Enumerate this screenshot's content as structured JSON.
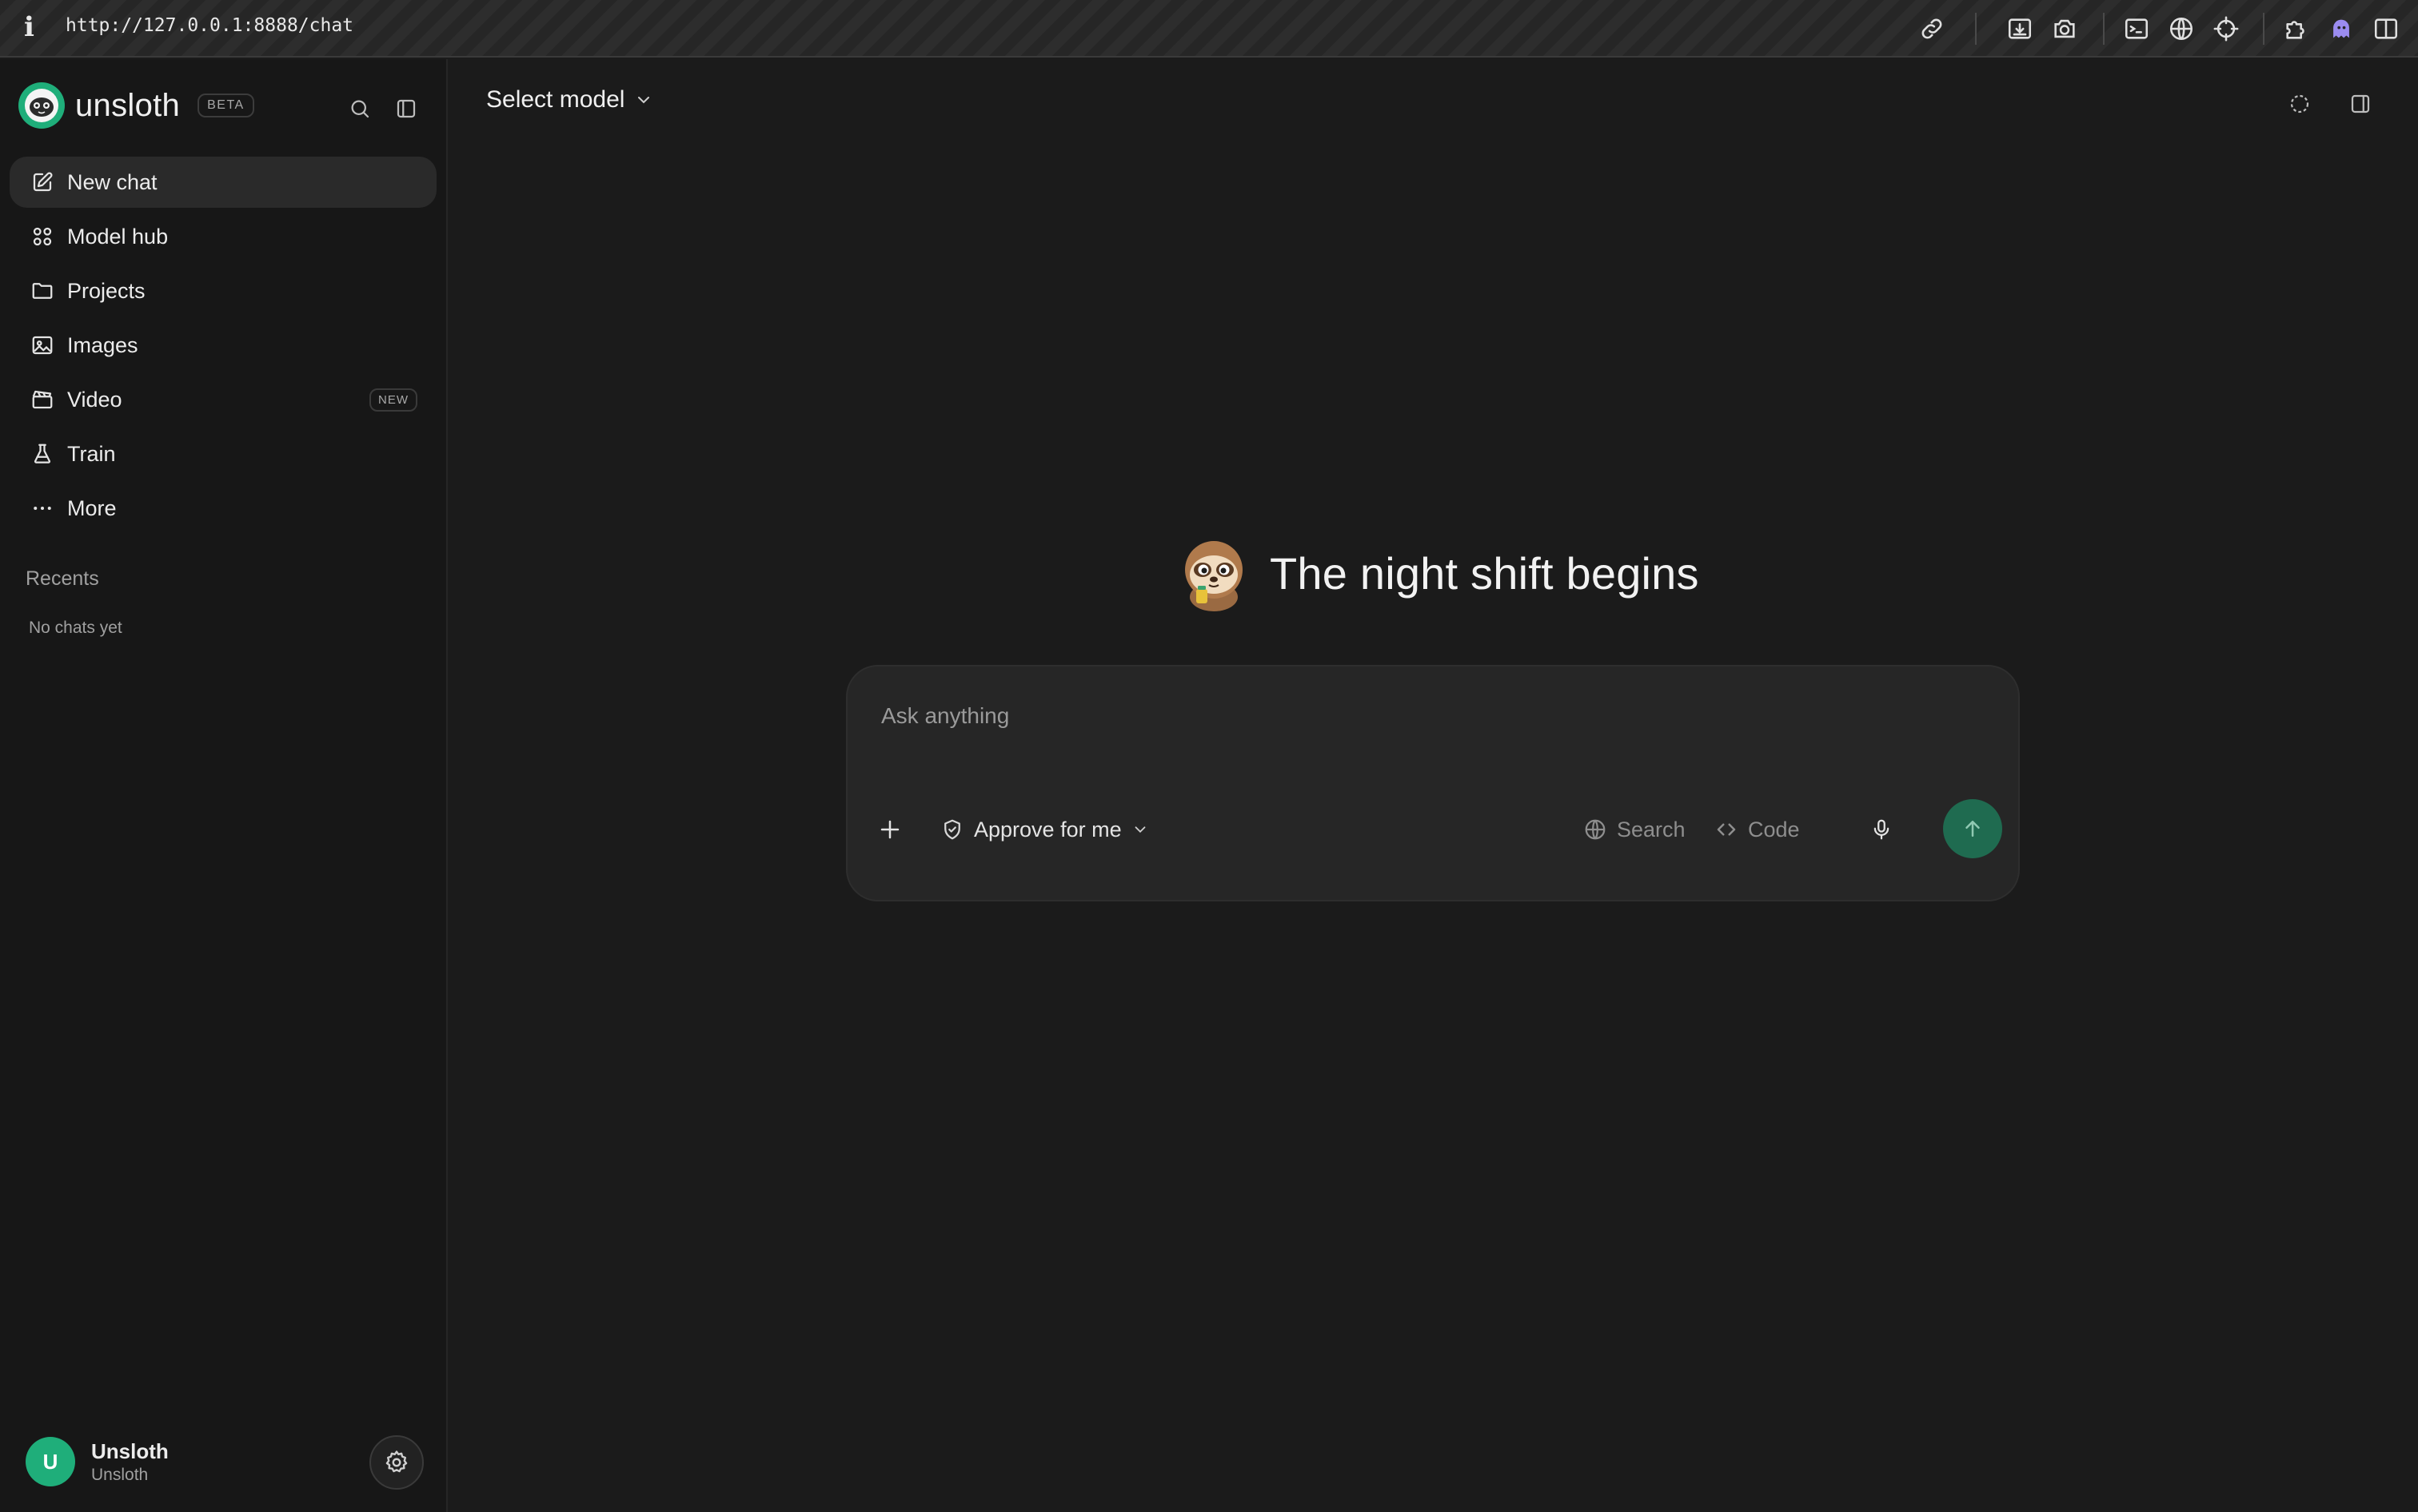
{
  "browser": {
    "info_glyph": "i",
    "url": "http://127.0.0.1:8888/chat",
    "toolbar_icons": [
      "link-icon",
      "download-box-icon",
      "camera-icon",
      "terminal-icon",
      "globe-icon",
      "crosshair-icon",
      "puzzle-icon",
      "ghost-icon",
      "split-view-icon"
    ]
  },
  "sidebar": {
    "brand": {
      "name": "unsloth",
      "badge": "BETA"
    },
    "nav": [
      {
        "id": "new-chat",
        "label": "New chat",
        "icon": "edit-icon",
        "active": true
      },
      {
        "id": "model-hub",
        "label": "Model hub",
        "icon": "grid-icon"
      },
      {
        "id": "projects",
        "label": "Projects",
        "icon": "folder-icon"
      },
      {
        "id": "images",
        "label": "Images",
        "icon": "image-icon"
      },
      {
        "id": "video",
        "label": "Video",
        "icon": "clapperboard-icon",
        "badge": "NEW"
      },
      {
        "id": "train",
        "label": "Train",
        "icon": "flask-icon"
      },
      {
        "id": "more",
        "label": "More",
        "icon": "ellipsis-icon"
      }
    ],
    "recents": {
      "heading": "Recents",
      "empty": "No chats yet"
    },
    "user": {
      "initial": "U",
      "name": "Unsloth",
      "subtitle": "Unsloth"
    }
  },
  "main": {
    "model_select": {
      "label": "Select model"
    },
    "greeting": {
      "title": "The night shift begins"
    },
    "composer": {
      "placeholder": "Ask anything",
      "value": "",
      "approve_label": "Approve for me",
      "search_label": "Search",
      "code_label": "Code"
    }
  },
  "colors": {
    "background": "#1b1b1b",
    "sidebar": "#171717",
    "composer": "#262626",
    "accent_green": "#1fae7a",
    "send_button": "#1f6b50"
  }
}
